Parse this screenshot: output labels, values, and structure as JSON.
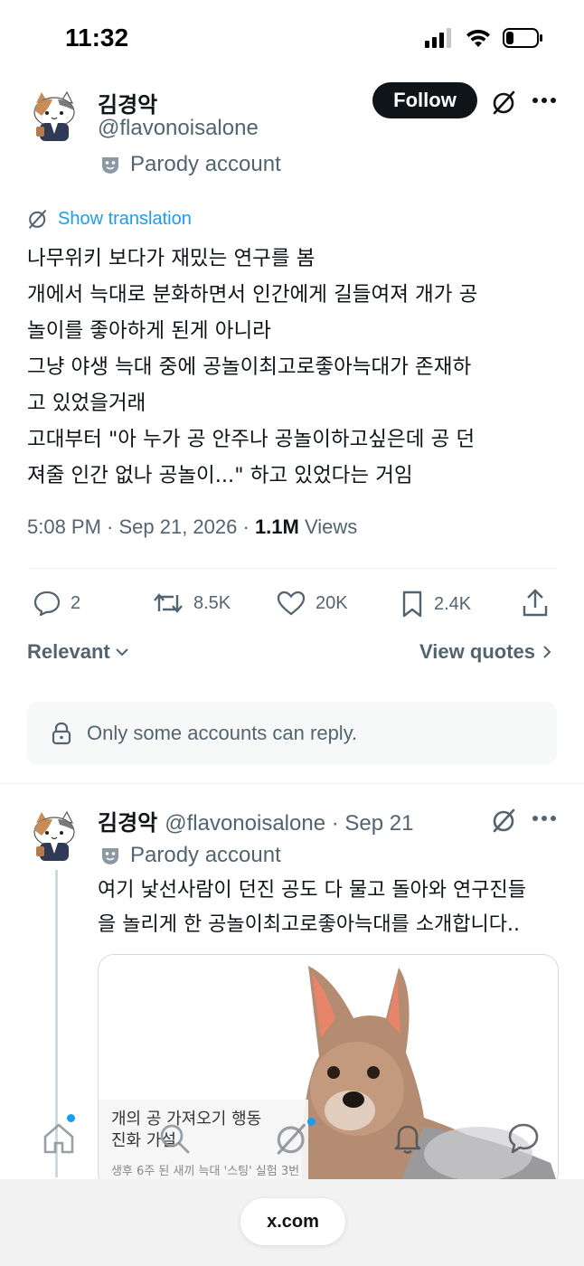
{
  "status_bar": {
    "time": "11:32"
  },
  "tweet": {
    "author_name": "김경악",
    "author_handle": "@flavonoisalone",
    "parody_label": "Parody account",
    "follow_label": "Follow",
    "show_translation": "Show translation",
    "body_lines": [
      "나무위키 보다가 재밌는 연구를 봄",
      "개에서 늑대로 분화하면서 인간에게 길들여져 개가 공",
      "놀이를 좋아하게 된게 아니라",
      "그냥 야생 늑대 중에 공놀이최고로좋아늑대가 존재하",
      "고 있었을거래",
      "고대부터  \"아 누가 공 안주나 공놀이하고싶은데 공 던",
      "져줄 인간 없나 공놀이...\" 하고 있었다는 거임"
    ],
    "timestamp": "5:08 PM · Sep 21, 2026 · ",
    "views_count": "1.1M",
    "views_label": " Views",
    "replies": "2",
    "reposts": "8.5K",
    "likes": "20K",
    "bookmarks": "2.4K"
  },
  "sort": {
    "relevant_label": "Relevant",
    "view_quotes_label": "View quotes"
  },
  "reply_restriction": "Only some accounts can reply.",
  "reply_tweet": {
    "author_name": "김경악",
    "author_handle": "@flavonoisalone · Sep 21",
    "parody_label": "Parody account",
    "body_lines": [
      "여기 낯선사람이 던진 공도 다 물고 돌아와 연구진들",
      "을 놀리게 한 공놀이최고로좋아늑대를 소개합니다.."
    ],
    "card_caption_lines": [
      "개의 공 가져오기 행동",
      "진화 가설"
    ],
    "card_subcaption": "생후 6주 된 새끼 늑대 '스팅' 실험 3번"
  },
  "browser": {
    "url": "x.com"
  },
  "colors": {
    "accent": "#1d9bf0",
    "text": "#0f1419",
    "secondary": "#536471",
    "border": "#cfd9de"
  }
}
